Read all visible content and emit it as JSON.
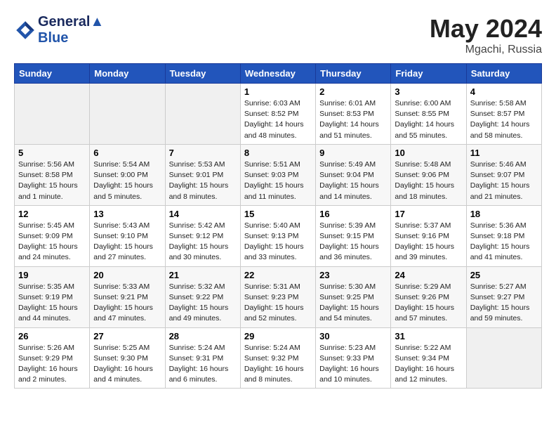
{
  "header": {
    "logo_line1": "General",
    "logo_line2": "Blue",
    "month_title": "May 2024",
    "location": "Mgachi, Russia"
  },
  "weekdays": [
    "Sunday",
    "Monday",
    "Tuesday",
    "Wednesday",
    "Thursday",
    "Friday",
    "Saturday"
  ],
  "weeks": [
    [
      {
        "day": "",
        "info": ""
      },
      {
        "day": "",
        "info": ""
      },
      {
        "day": "",
        "info": ""
      },
      {
        "day": "1",
        "info": "Sunrise: 6:03 AM\nSunset: 8:52 PM\nDaylight: 14 hours\nand 48 minutes."
      },
      {
        "day": "2",
        "info": "Sunrise: 6:01 AM\nSunset: 8:53 PM\nDaylight: 14 hours\nand 51 minutes."
      },
      {
        "day": "3",
        "info": "Sunrise: 6:00 AM\nSunset: 8:55 PM\nDaylight: 14 hours\nand 55 minutes."
      },
      {
        "day": "4",
        "info": "Sunrise: 5:58 AM\nSunset: 8:57 PM\nDaylight: 14 hours\nand 58 minutes."
      }
    ],
    [
      {
        "day": "5",
        "info": "Sunrise: 5:56 AM\nSunset: 8:58 PM\nDaylight: 15 hours\nand 1 minute."
      },
      {
        "day": "6",
        "info": "Sunrise: 5:54 AM\nSunset: 9:00 PM\nDaylight: 15 hours\nand 5 minutes."
      },
      {
        "day": "7",
        "info": "Sunrise: 5:53 AM\nSunset: 9:01 PM\nDaylight: 15 hours\nand 8 minutes."
      },
      {
        "day": "8",
        "info": "Sunrise: 5:51 AM\nSunset: 9:03 PM\nDaylight: 15 hours\nand 11 minutes."
      },
      {
        "day": "9",
        "info": "Sunrise: 5:49 AM\nSunset: 9:04 PM\nDaylight: 15 hours\nand 14 minutes."
      },
      {
        "day": "10",
        "info": "Sunrise: 5:48 AM\nSunset: 9:06 PM\nDaylight: 15 hours\nand 18 minutes."
      },
      {
        "day": "11",
        "info": "Sunrise: 5:46 AM\nSunset: 9:07 PM\nDaylight: 15 hours\nand 21 minutes."
      }
    ],
    [
      {
        "day": "12",
        "info": "Sunrise: 5:45 AM\nSunset: 9:09 PM\nDaylight: 15 hours\nand 24 minutes."
      },
      {
        "day": "13",
        "info": "Sunrise: 5:43 AM\nSunset: 9:10 PM\nDaylight: 15 hours\nand 27 minutes."
      },
      {
        "day": "14",
        "info": "Sunrise: 5:42 AM\nSunset: 9:12 PM\nDaylight: 15 hours\nand 30 minutes."
      },
      {
        "day": "15",
        "info": "Sunrise: 5:40 AM\nSunset: 9:13 PM\nDaylight: 15 hours\nand 33 minutes."
      },
      {
        "day": "16",
        "info": "Sunrise: 5:39 AM\nSunset: 9:15 PM\nDaylight: 15 hours\nand 36 minutes."
      },
      {
        "day": "17",
        "info": "Sunrise: 5:37 AM\nSunset: 9:16 PM\nDaylight: 15 hours\nand 39 minutes."
      },
      {
        "day": "18",
        "info": "Sunrise: 5:36 AM\nSunset: 9:18 PM\nDaylight: 15 hours\nand 41 minutes."
      }
    ],
    [
      {
        "day": "19",
        "info": "Sunrise: 5:35 AM\nSunset: 9:19 PM\nDaylight: 15 hours\nand 44 minutes."
      },
      {
        "day": "20",
        "info": "Sunrise: 5:33 AM\nSunset: 9:21 PM\nDaylight: 15 hours\nand 47 minutes."
      },
      {
        "day": "21",
        "info": "Sunrise: 5:32 AM\nSunset: 9:22 PM\nDaylight: 15 hours\nand 49 minutes."
      },
      {
        "day": "22",
        "info": "Sunrise: 5:31 AM\nSunset: 9:23 PM\nDaylight: 15 hours\nand 52 minutes."
      },
      {
        "day": "23",
        "info": "Sunrise: 5:30 AM\nSunset: 9:25 PM\nDaylight: 15 hours\nand 54 minutes."
      },
      {
        "day": "24",
        "info": "Sunrise: 5:29 AM\nSunset: 9:26 PM\nDaylight: 15 hours\nand 57 minutes."
      },
      {
        "day": "25",
        "info": "Sunrise: 5:27 AM\nSunset: 9:27 PM\nDaylight: 15 hours\nand 59 minutes."
      }
    ],
    [
      {
        "day": "26",
        "info": "Sunrise: 5:26 AM\nSunset: 9:29 PM\nDaylight: 16 hours\nand 2 minutes."
      },
      {
        "day": "27",
        "info": "Sunrise: 5:25 AM\nSunset: 9:30 PM\nDaylight: 16 hours\nand 4 minutes."
      },
      {
        "day": "28",
        "info": "Sunrise: 5:24 AM\nSunset: 9:31 PM\nDaylight: 16 hours\nand 6 minutes."
      },
      {
        "day": "29",
        "info": "Sunrise: 5:24 AM\nSunset: 9:32 PM\nDaylight: 16 hours\nand 8 minutes."
      },
      {
        "day": "30",
        "info": "Sunrise: 5:23 AM\nSunset: 9:33 PM\nDaylight: 16 hours\nand 10 minutes."
      },
      {
        "day": "31",
        "info": "Sunrise: 5:22 AM\nSunset: 9:34 PM\nDaylight: 16 hours\nand 12 minutes."
      },
      {
        "day": "",
        "info": ""
      }
    ]
  ]
}
